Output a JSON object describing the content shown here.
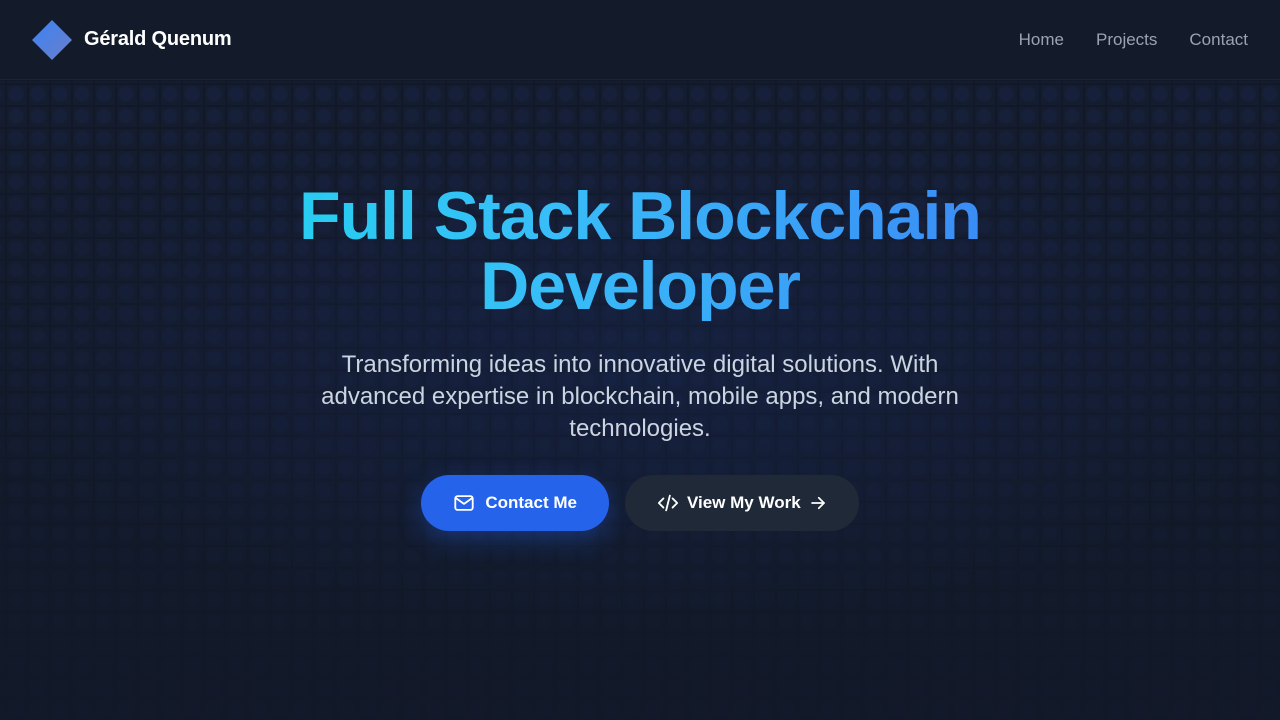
{
  "header": {
    "brand_name": "Gérald Quenum",
    "nav": [
      {
        "label": "Home"
      },
      {
        "label": "Projects"
      },
      {
        "label": "Contact"
      }
    ]
  },
  "hero": {
    "title": "Full Stack Blockchain Developer",
    "subtitle": "Transforming ideas into innovative digital solutions. With advanced expertise in blockchain, mobile apps, and modern technologies.",
    "primary_button": {
      "label": "Contact Me",
      "icon": "mail-icon"
    },
    "secondary_button": {
      "label": "View My Work",
      "icon": "code-icon",
      "trailing_icon": "arrow-right-icon"
    }
  },
  "colors": {
    "background": "#111827",
    "accent": "#2563eb",
    "title_gradient_start": "#22d3ee",
    "title_gradient_end": "#3b82f6"
  }
}
